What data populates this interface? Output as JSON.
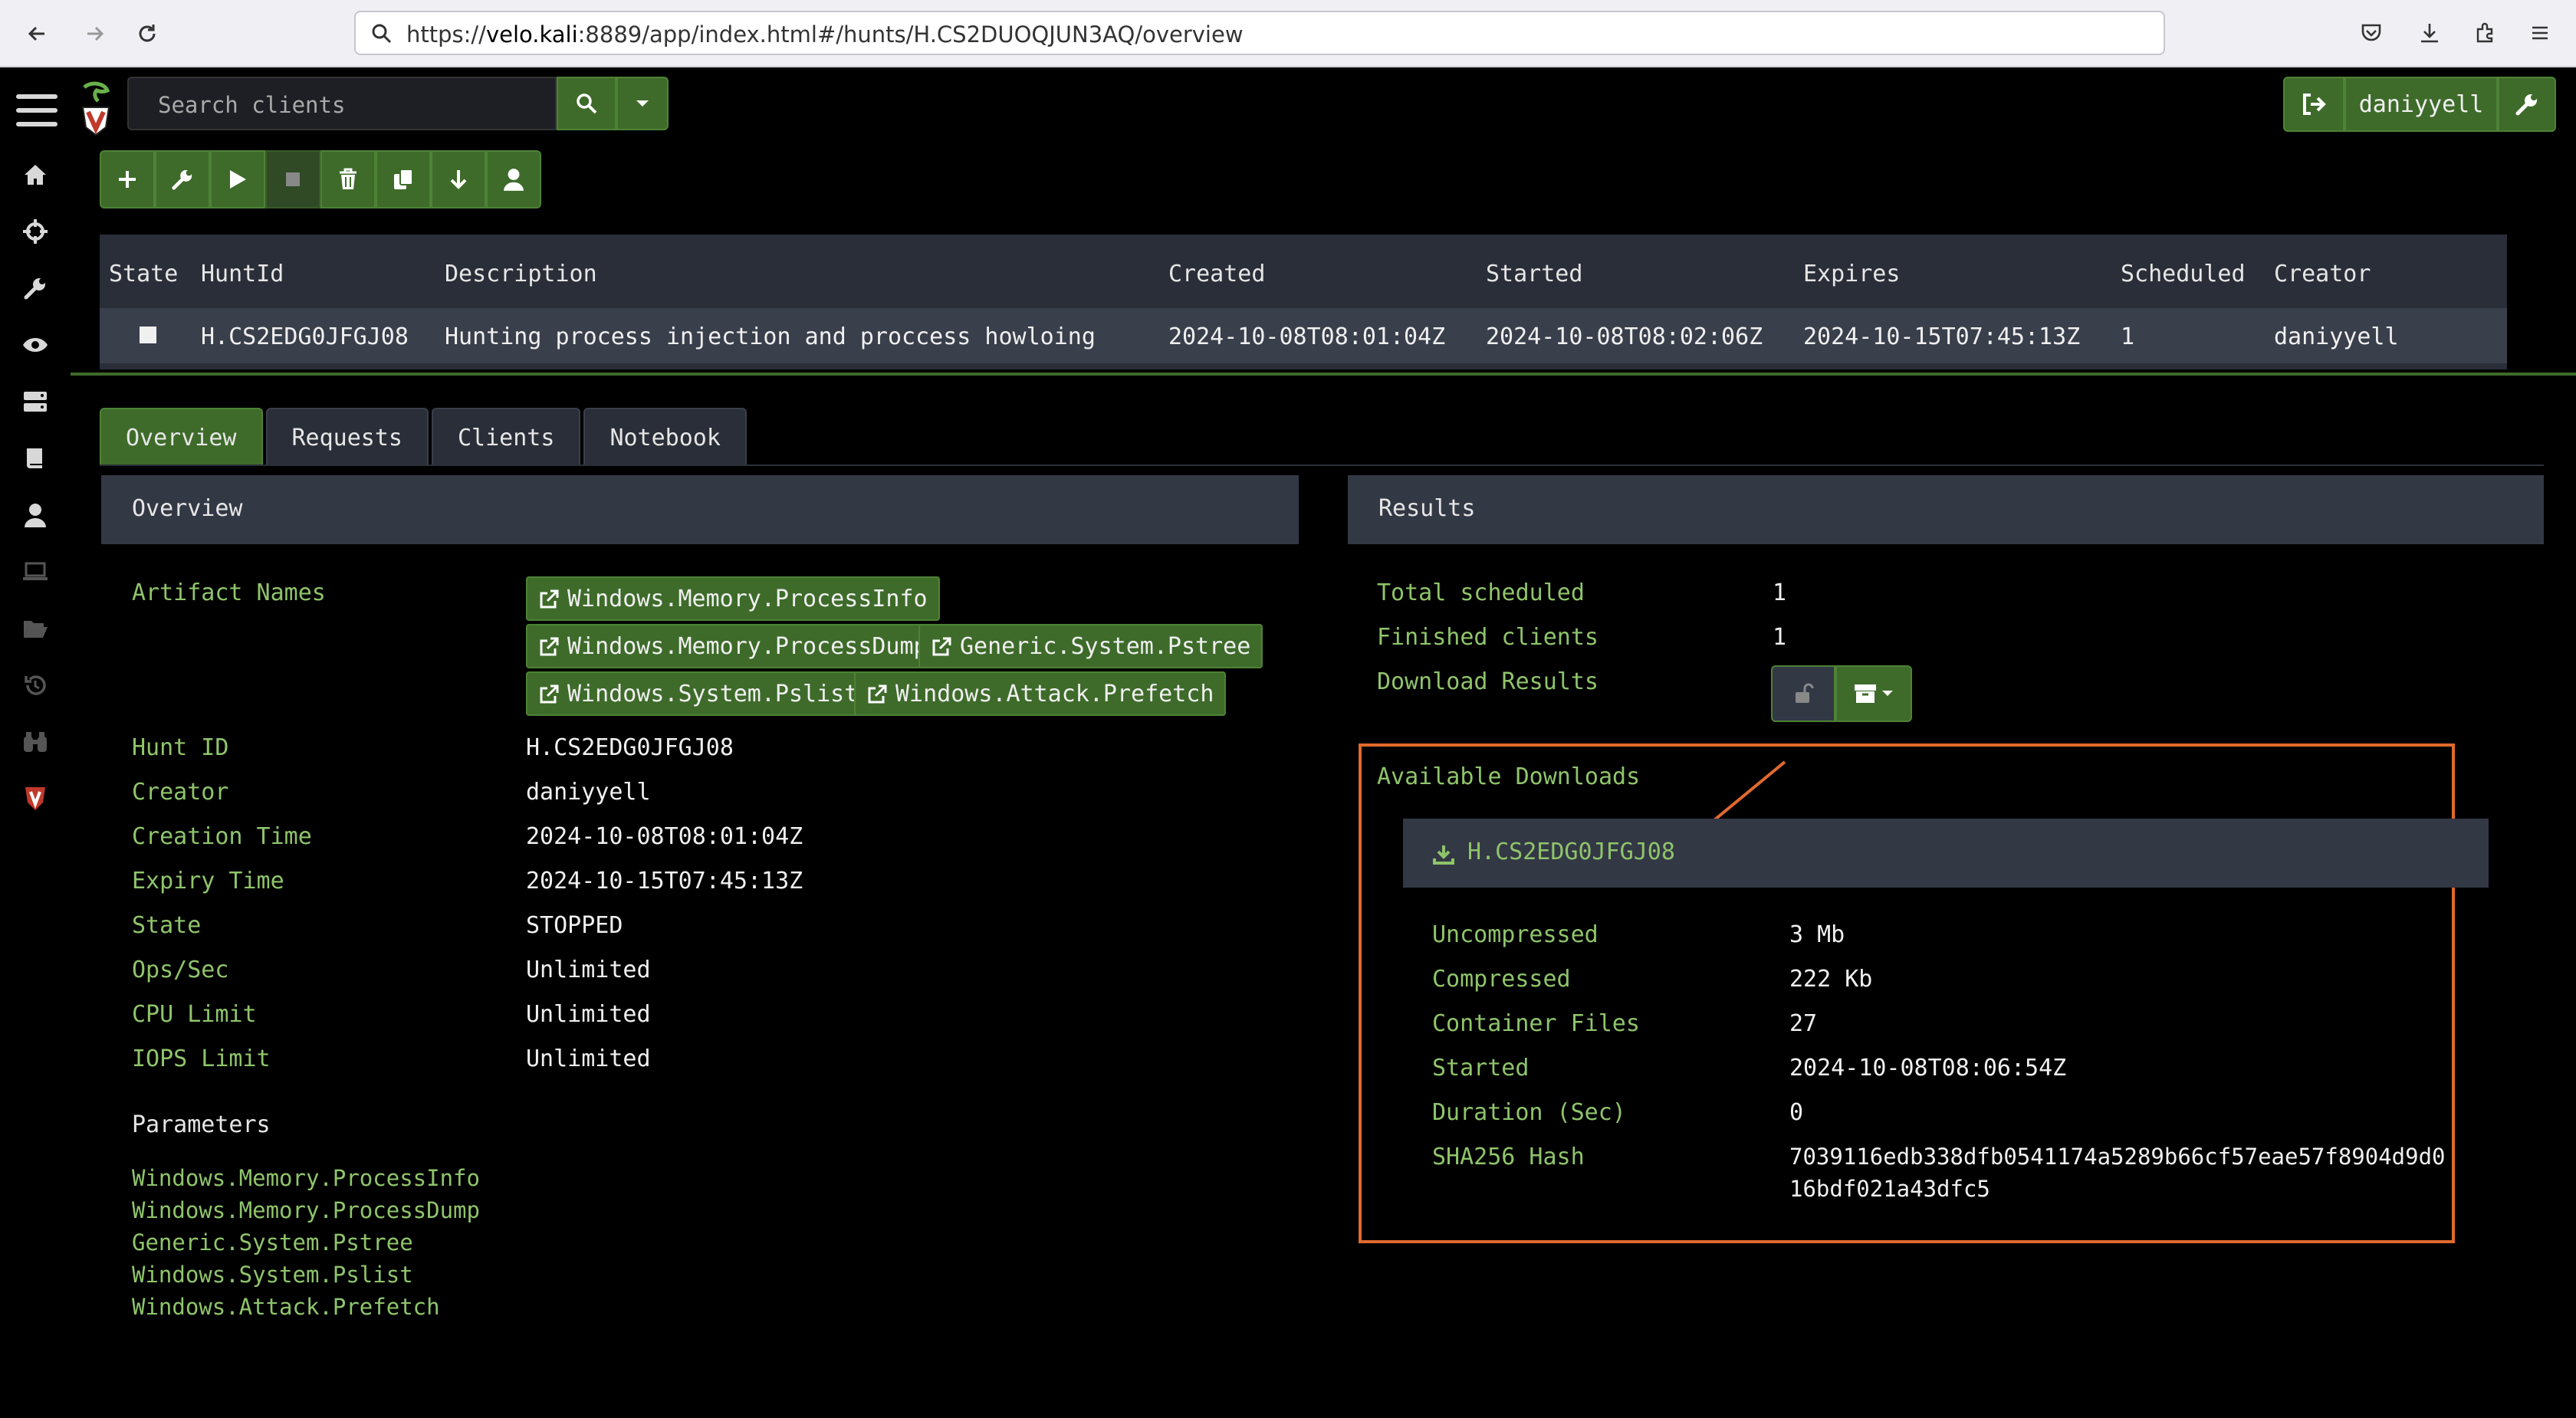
{
  "browser": {
    "url_prefix": "https://",
    "url_host": "velo.kali",
    "url_rest": ":8889/app/index.html#/hunts/H.CS2DUOQJUN3AQ/overview"
  },
  "search": {
    "placeholder": "Search clients"
  },
  "user": {
    "name": "daniyyell"
  },
  "hunts_table": {
    "headers": [
      "State",
      "HuntId",
      "Description",
      "Created",
      "Started",
      "Expires",
      "Scheduled",
      "Creator"
    ],
    "row": {
      "hunt_id": "H.CS2EDG0JFGJ08",
      "description": "Hunting process injection and proccess howloing",
      "created": "2024-10-08T08:01:04Z",
      "started": "2024-10-08T08:02:06Z",
      "expires": "2024-10-15T07:45:13Z",
      "scheduled": "1",
      "creator": "daniyyell"
    }
  },
  "tabs": [
    "Overview",
    "Requests",
    "Clients",
    "Notebook"
  ],
  "overview": {
    "title": "Overview",
    "artifact_names_label": "Artifact Names",
    "artifacts": [
      "Windows.Memory.ProcessInfo",
      "Windows.Memory.ProcessDump",
      "Generic.System.Pstree",
      "Windows.System.Pslist",
      "Windows.Attack.Prefetch"
    ],
    "fields": [
      {
        "label": "Hunt ID",
        "value": "H.CS2EDG0JFGJ08"
      },
      {
        "label": "Creator",
        "value": "daniyyell"
      },
      {
        "label": "Creation Time",
        "value": "2024-10-08T08:01:04Z"
      },
      {
        "label": "Expiry Time",
        "value": "2024-10-15T07:45:13Z"
      },
      {
        "label": "State",
        "value": "STOPPED"
      },
      {
        "label": "Ops/Sec",
        "value": "Unlimited"
      },
      {
        "label": "CPU Limit",
        "value": "Unlimited"
      },
      {
        "label": "IOPS Limit",
        "value": "Unlimited"
      }
    ],
    "parameters_label": "Parameters",
    "parameters": [
      "Windows.Memory.ProcessInfo",
      "Windows.Memory.ProcessDump",
      "Generic.System.Pstree",
      "Windows.System.Pslist",
      "Windows.Attack.Prefetch"
    ]
  },
  "results": {
    "title": "Results",
    "fields": [
      {
        "label": "Total scheduled",
        "value": "1"
      },
      {
        "label": "Finished clients",
        "value": "1"
      },
      {
        "label": "Download Results",
        "value": ""
      }
    ],
    "available_downloads_label": "Available Downloads",
    "download_name": "H.CS2EDG0JFGJ08",
    "download_fields": [
      {
        "label": "Uncompressed",
        "value": "3 Mb"
      },
      {
        "label": "Compressed",
        "value": "222 Kb"
      },
      {
        "label": "Container Files",
        "value": "27"
      },
      {
        "label": "Started",
        "value": "2024-10-08T08:06:54Z"
      },
      {
        "label": "Duration (Sec)",
        "value": "0"
      },
      {
        "label": "SHA256 Hash",
        "value": "7039116edb338dfb0541174a5289b66cf57eae57f8904d9d0",
        "value2": "16bdf021a43dfc5"
      }
    ]
  },
  "colors": {
    "accent_green": "#3e6b2a",
    "label_green": "#8fc46b",
    "highlight_orange": "#e06a2e"
  }
}
